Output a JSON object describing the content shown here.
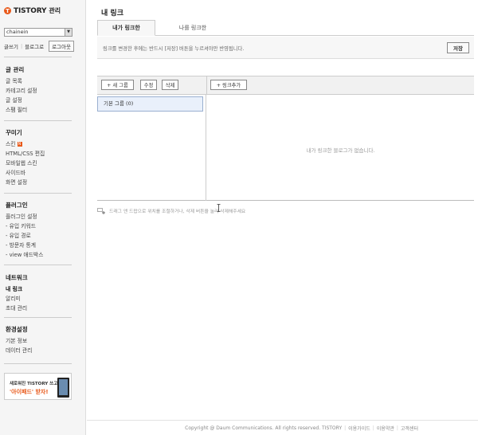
{
  "brand": {
    "badge": "T",
    "name": "TISTORY",
    "suffix": "관리"
  },
  "blog_selector": {
    "value": "chainein"
  },
  "top_links": {
    "write": "글쓰기",
    "blog": "블로그로",
    "logout": "로그아웃"
  },
  "nav": [
    {
      "title": "글 관리",
      "items": [
        "글 목록",
        "카테고리 설정",
        "글 설정",
        "스팸 필터"
      ]
    },
    {
      "title": "꾸미기",
      "items": [
        "스킨",
        "HTML/CSS 편집",
        "모바일웹 스킨",
        "사이드바",
        "화면 설정"
      ]
    },
    {
      "title": "플러그인",
      "items": [
        "플러그인 설정",
        "- 유입 키워드",
        "- 유입 경로",
        "- 방문자 통계",
        "- view 애드박스"
      ]
    },
    {
      "title": "네트워크",
      "items": [
        "내 링크",
        "알리미",
        "초대 관리"
      ]
    },
    {
      "title": "환경설정",
      "items": [
        "기본 정보",
        "데이터 관리"
      ]
    }
  ],
  "ad": {
    "line1": "새로워진 TISTORY 쓰고",
    "line2": "'아이패드' 받자!"
  },
  "main": {
    "title": "내 링크",
    "tabs": [
      {
        "label": "내가 링크한"
      },
      {
        "label": "나를 링크한"
      }
    ],
    "notice": "링크를 변경한 후에는 반드시 [저장] 버튼을 누르셔야만 반영됩니다.",
    "save_label": "저장",
    "toolbar": {
      "new_group": "+ 새 그룹",
      "edit": "수정",
      "delete": "삭제",
      "add_link": "+ 링크추가"
    },
    "groups": [
      {
        "label": "기본 그룹 (0)"
      }
    ],
    "empty_message": "내가 링크한 블로그가 없습니다.",
    "hint": "드래그 앤 드랍으로 위치를 조절하거나, 삭제 버튼을 눌러 삭제해주세요"
  },
  "footer": {
    "copyright": "Copyright @ Daum Communications. All rights reserved. TISTORY",
    "links": [
      "이용가이드",
      "이용약관",
      "고객센터"
    ]
  }
}
